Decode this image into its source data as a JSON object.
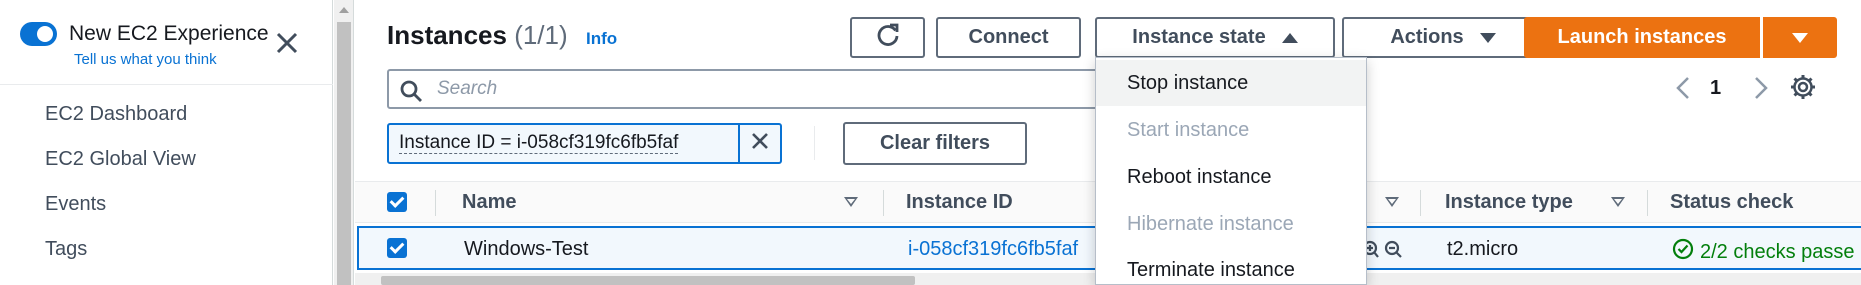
{
  "sidebar": {
    "experience_toggle_label": "New EC2 Experience",
    "feedback_link": "Tell us what you think",
    "nav_items": [
      {
        "label": "EC2 Dashboard"
      },
      {
        "label": "EC2 Global View"
      },
      {
        "label": "Events"
      },
      {
        "label": "Tags"
      }
    ]
  },
  "header": {
    "title": "Instances",
    "count": "(1/1)",
    "info_link": "Info",
    "connect_label": "Connect",
    "instance_state_label": "Instance state",
    "actions_label": "Actions",
    "launch_label": "Launch instances"
  },
  "search": {
    "placeholder": "Search",
    "value": ""
  },
  "pagination": {
    "current_page": "1"
  },
  "filter": {
    "token_label": "Instance ID = i-058cf319fc6fb5faf",
    "clear_label": "Clear filters"
  },
  "table": {
    "columns": [
      "Name",
      "Instance ID",
      "Instance type",
      "Status check"
    ],
    "rows": [
      {
        "name": "Windows-Test",
        "instance_id": "i-058cf319fc6fb5faf",
        "instance_type": "t2.micro",
        "status_check": "2/2 checks passe"
      }
    ]
  },
  "instance_state_menu": {
    "items": [
      {
        "label": "Stop instance",
        "enabled": true
      },
      {
        "label": "Start instance",
        "enabled": false
      },
      {
        "label": "Reboot instance",
        "enabled": true
      },
      {
        "label": "Hibernate instance",
        "enabled": false
      },
      {
        "label": "Terminate instance",
        "enabled": true
      }
    ]
  },
  "colors": {
    "accent": "#0972d3",
    "launch_button": "#ec7211",
    "status_success": "#037f0c"
  },
  "icons": [
    "close-icon",
    "refresh-icon",
    "search-icon",
    "chevron-left-icon",
    "chevron-right-icon",
    "gear-icon",
    "zoom-in-icon",
    "zoom-out-icon",
    "check-circle-icon"
  ]
}
